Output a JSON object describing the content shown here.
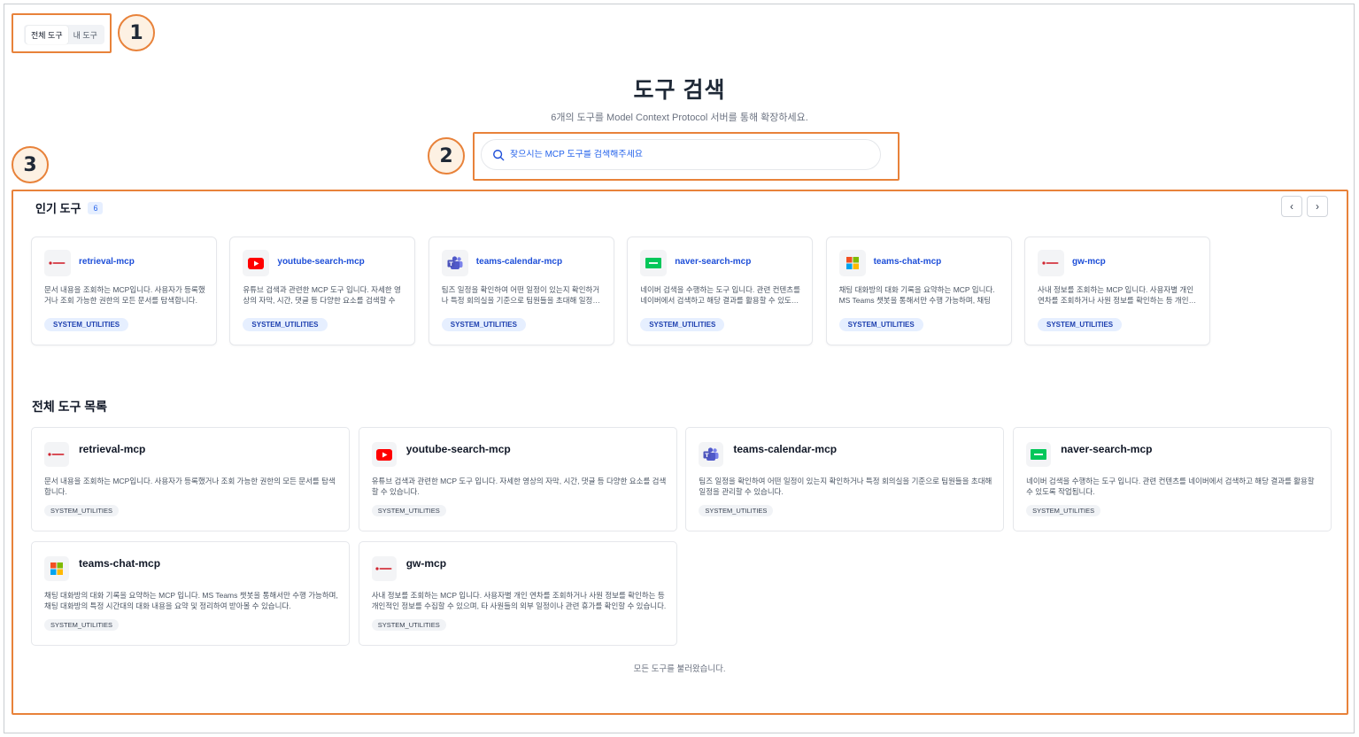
{
  "tabs": [
    {
      "label": "전체 도구",
      "active": true
    },
    {
      "label": "내 도구",
      "active": false
    }
  ],
  "header": {
    "title": "도구 검색",
    "subtitle": "6개의 도구를 Model Context Protocol 서버를 통해 확장하세요."
  },
  "search": {
    "placeholder": "찾으시는 MCP 도구를 검색해주세요",
    "value": ""
  },
  "annotations": [
    "1",
    "2",
    "3"
  ],
  "popular": {
    "title": "인기 도구",
    "count": "6",
    "prev_icon": "chevron-left-icon",
    "next_icon": "chevron-right-icon",
    "cards": [
      {
        "name": "retrieval-mcp",
        "icon": "doowon-logo-icon",
        "desc": "문서 내용을 조회하는 MCP입니다. 사용자가 등록했거나 조회 가능한 권한의 모든 문서를 탐색합니다.",
        "tag": "SYSTEM_UTILITIES"
      },
      {
        "name": "youtube-search-mcp",
        "icon": "youtube-icon",
        "desc": "유튜브 검색과 관련한 MCP 도구 입니다. 자세한 영상의 자막, 시간, 댓글 등 다양한 요소를 검색할 수 …",
        "tag": "SYSTEM_UTILITIES"
      },
      {
        "name": "teams-calendar-mcp",
        "icon": "teams-icon",
        "desc": "팀즈 일정을 확인하여 어떤 일정이 있는지 확인하거나 특정 회의실을 기준으로 팀원들을 초대해 일정…",
        "tag": "SYSTEM_UTILITIES"
      },
      {
        "name": "naver-search-mcp",
        "icon": "naver-icon",
        "desc": "네이버 검색을 수행하는 도구 입니다. 관련 컨텐츠를 네이버에서 검색하고 해당 결과를 활용할 수 있도…",
        "tag": "SYSTEM_UTILITIES"
      },
      {
        "name": "teams-chat-mcp",
        "icon": "microsoft-icon",
        "desc": "채팅 대화방의 대화 기록을 요약하는 MCP 입니다. MS Teams 챗봇을 통해서만 수행 가능하며, 채팅 …",
        "tag": "SYSTEM_UTILITIES"
      },
      {
        "name": "gw-mcp",
        "icon": "doowon-logo-icon",
        "desc": "사내 정보를 조회하는 MCP 입니다. 사용자별 개인 연차를 조회하거나 사원 정보를 확인하는 등 개인…",
        "tag": "SYSTEM_UTILITIES"
      }
    ]
  },
  "all_tools": {
    "title": "전체 도구 목록",
    "cards": [
      {
        "name": "retrieval-mcp",
        "icon": "doowon-logo-icon",
        "desc": "문서 내용을 조회하는 MCP입니다. 사용자가 등록했거나 조회 가능한 권한의 모든 문서를 탐색합니다.",
        "tag": "SYSTEM_UTILITIES"
      },
      {
        "name": "youtube-search-mcp",
        "icon": "youtube-icon",
        "desc": "유튜브 검색과 관련한 MCP 도구 입니다. 자세한 영상의 자막, 시간, 댓글 등 다양한 요소를 검색할 수 있습니다.",
        "tag": "SYSTEM_UTILITIES"
      },
      {
        "name": "teams-calendar-mcp",
        "icon": "teams-icon",
        "desc": "팀즈 일정을 확인하여 어떤 일정이 있는지 확인하거나 특정 회의실을 기준으로 팀원들을 초대해 일정을 관리할 수 있습니다.",
        "tag": "SYSTEM_UTILITIES"
      },
      {
        "name": "naver-search-mcp",
        "icon": "naver-icon",
        "desc": "네이버 검색을 수행하는 도구 입니다. 관련 컨텐츠를 네이버에서 검색하고 해당 결과를 활용할 수 있도록 작업됩니다.",
        "tag": "SYSTEM_UTILITIES"
      },
      {
        "name": "teams-chat-mcp",
        "icon": "microsoft-icon",
        "desc": "채팅 대화방의 대화 기록을 요약하는 MCP 입니다. MS Teams 챗봇을 통해서만 수행 가능하며, 채팅 대화방의 특정 시간대의 대화 내용을 요약 및 정리하여 받아볼 수 있습니다.",
        "tag": "SYSTEM_UTILITIES"
      },
      {
        "name": "gw-mcp",
        "icon": "doowon-logo-icon",
        "desc": "사내 정보를 조회하는 MCP 입니다. 사용자별 개인 연차를 조회하거나 사원 정보를 확인하는 등 개인적인 정보를 수집할 수 있으며, 타 사원들의 외부 일정이나 관련 휴가를 확인할 수 있습니다.",
        "tag": "SYSTEM_UTILITIES"
      }
    ]
  },
  "footer": {
    "message": "모든 도구를 불러왔습니다."
  },
  "colors": {
    "annotation": "#e8823a",
    "link": "#1d4ed8",
    "tag_bg": "#e6efff"
  }
}
